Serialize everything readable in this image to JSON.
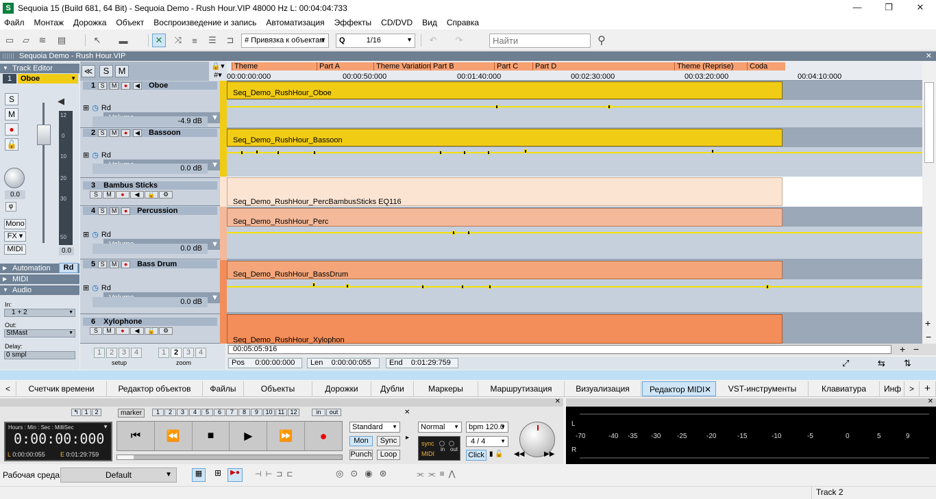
{
  "title_bar": {
    "title": "Sequoia 15 (Build 681, 64 Bit)  -  Sequoia Demo - Rush Hour.VIP   48000 Hz L: 00:04:04:733"
  },
  "menu": [
    "Файл",
    "Монтаж",
    "Дорожка",
    "Объект",
    "Воспроизведение и запись",
    "Автоматизация",
    "Эффекты",
    "CD/DVD",
    "Вид",
    "Справка"
  ],
  "toolbar": {
    "snap_label": "Привязка к объектам",
    "grid_value": "1/16",
    "search_placeholder": "Найти"
  },
  "project": {
    "name": "Sequoia Demo - Rush Hour.VIP"
  },
  "left_panel": {
    "track_editor_label": "Track Editor",
    "track_number": "1",
    "track_name": "Oboe",
    "s": "S",
    "m": "M",
    "pan_value": "0.0",
    "fader_value": "0.0",
    "mono_label": "Mono",
    "fx_label": "FX",
    "midi_label": "MIDI",
    "automation_label": "Automation",
    "rd_label": "Rd",
    "midi_section": "MIDI",
    "audio_section": "Audio",
    "in_label": "In:",
    "in_value": "1 + 2",
    "out_label": "Out:",
    "out_value": "StMast",
    "delay_label": "Delay:",
    "delay_value": "0 smpl",
    "scale_marks": [
      "12",
      "0",
      "10",
      "20",
      "30",
      "50"
    ]
  },
  "track_header": {
    "ss": "S",
    "mm": "M"
  },
  "tracks": [
    {
      "num": "1",
      "name": "Oboe",
      "clip": "Seq_Demo_RushHour_Oboe",
      "volume_label": "Volume",
      "db": "-4.9 dB",
      "color": "#f1cc14"
    },
    {
      "num": "2",
      "name": "Bassoon",
      "clip": "Seq_Demo_RushHour_Bassoon",
      "volume_label": "Volume",
      "db": "0.0 dB",
      "color": "#f1cc14"
    },
    {
      "num": "3",
      "name": "Bambus Sticks",
      "clip": "Seq_Demo_RushHour_PercBambusSticks   EQ116",
      "color": "#fbe4d2"
    },
    {
      "num": "4",
      "name": "Percussion",
      "clip": "Seq_Demo_RushHour_Perc",
      "volume_label": "Volume",
      "db": "0.0 dB",
      "color": "#f4b99a"
    },
    {
      "num": "5",
      "name": "Bass Drum",
      "clip": "Seq_Demo_RushHour_BassDrum",
      "volume_label": "Volume",
      "db": "0.0 dB",
      "color": "#f4a67a"
    },
    {
      "num": "6",
      "name": "Xylophone",
      "clip": "Seq_Demo_RushHour_Xylophon",
      "color": "#f38d59"
    }
  ],
  "markers": [
    "Theme",
    "Part A",
    "Theme Variation",
    "Part B",
    "Part C",
    "Part D",
    "Theme (Reprise)",
    "Coda"
  ],
  "timecodes": [
    "00:00:00:000",
    "00:00:50:000",
    "00:01:40:000",
    "00:02:30:000",
    "00:03:20:000",
    "00:04:10:000"
  ],
  "status": {
    "timecode": "00:05:05:916",
    "pos_label": "Pos",
    "pos": "0:00:00:000",
    "len_label": "Len",
    "len": "0:00:00:055",
    "end_label": "End",
    "end": "0:01:29:759"
  },
  "zoom": {
    "setup_label": "setup",
    "zoom_label": "zoom",
    "setup_nums": [
      "1",
      "2",
      "3",
      "4"
    ],
    "zoom_nums": [
      "1",
      "2",
      "3",
      "4"
    ]
  },
  "tabs": [
    "Счетчик времени",
    "Редактор объектов",
    "Файлы",
    "Объекты",
    "Дорожки",
    "Дубли",
    "Маркеры",
    "Маршрутизация",
    "Визуализация",
    "Редактор MIDI",
    "VST-инструменты",
    "Клавиатура",
    "Инф"
  ],
  "transport": {
    "counter_format": "Hours : Min : Sec : MilliSec",
    "counter": "0:00:00:000",
    "l_label": "L",
    "l_value": "0:00:00:055",
    "e_label": "E",
    "e_value": "0:01:29:759",
    "marker_label": "marker",
    "marker_nums": [
      "1",
      "2",
      "3",
      "4",
      "5",
      "6",
      "7",
      "8",
      "9",
      "10",
      "11",
      "12"
    ],
    "undo_nums": [
      "1",
      "2"
    ],
    "in_label": "in",
    "out_label": "out",
    "mode": "Standard",
    "mon": "Mon",
    "sync": "Sync",
    "punch": "Punch",
    "loop": "Loop",
    "play_mode": "Normal",
    "bpm": "bpm  120.0",
    "signature": "4 / 4",
    "sync_label": "sync",
    "midi_label": "MIDI",
    "in_small": "in",
    "out_small": "out",
    "click": "Click"
  },
  "meters": {
    "labels": [
      "-70",
      "-40",
      "-35",
      "-30",
      "-25",
      "-20",
      "-15",
      "-10",
      "-5",
      "0",
      "5",
      "9"
    ],
    "l": "L",
    "r": "R"
  },
  "workspace": {
    "label": "Рабочая среда:",
    "value": "Default"
  },
  "statusbar": {
    "track": "Track 2"
  }
}
